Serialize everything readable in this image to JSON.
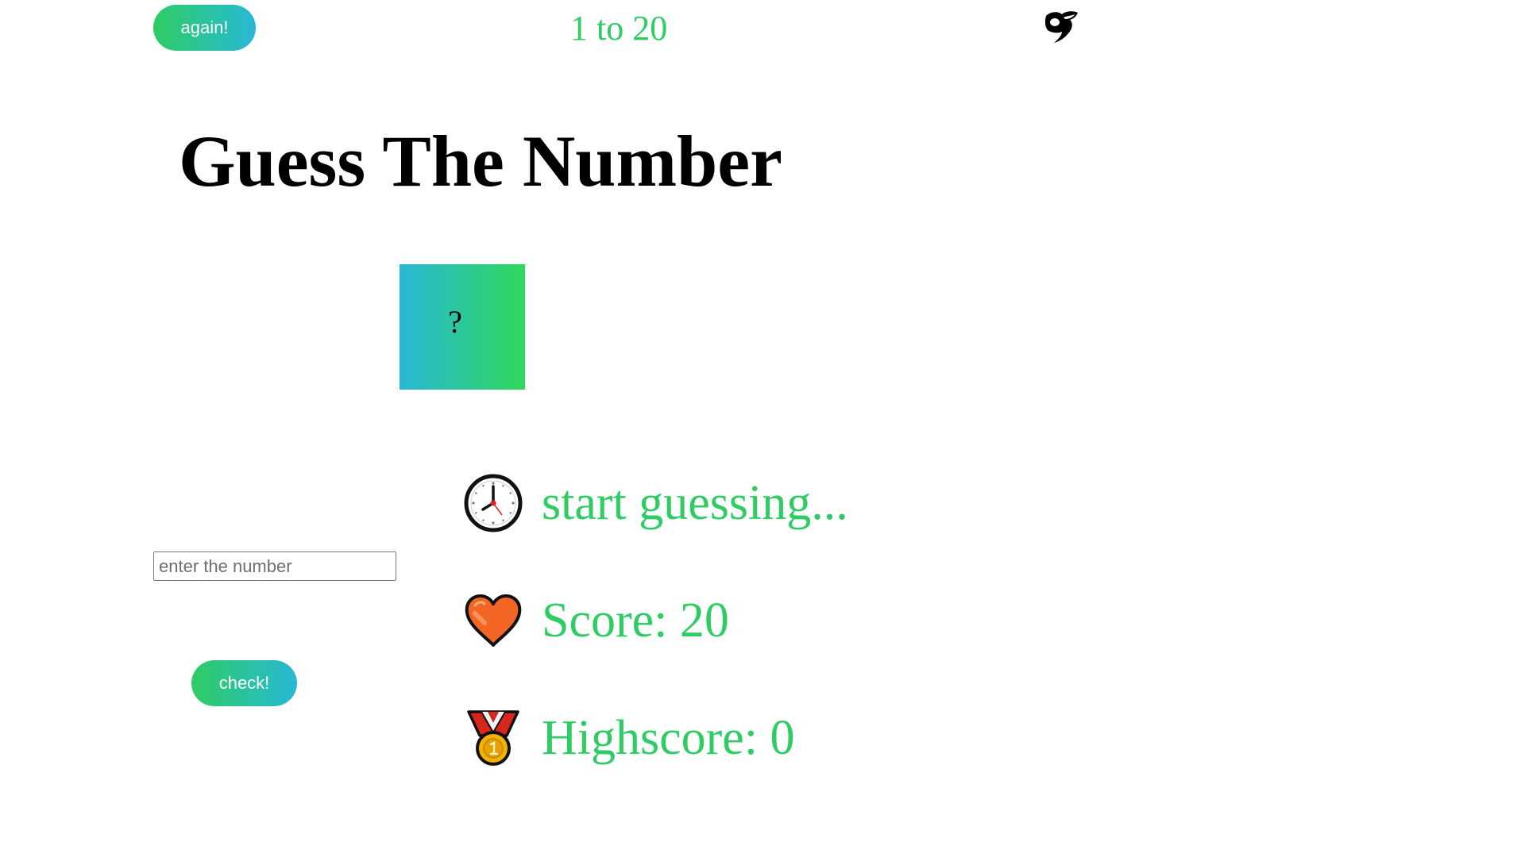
{
  "header": {
    "again_label": "again!",
    "range_text": "1 to 20",
    "logo_icon": "bird-logo-icon"
  },
  "title": "Guess The Number",
  "secret": {
    "value": "?"
  },
  "input": {
    "placeholder": "enter the number",
    "value": ""
  },
  "check_label": "check!",
  "stats": {
    "message": "start guessing...",
    "message_icon": "clock-icon",
    "score": "Score: 20",
    "score_icon": "heart-icon",
    "highscore": "Highscore: 0",
    "highscore_icon": "medal-icon"
  },
  "colors": {
    "accent_green": "#2ecc63",
    "accent_teal": "#27b8d6",
    "heart": "#f26522",
    "medal_gold": "#f5b301",
    "ribbon_red": "#d7261e"
  }
}
